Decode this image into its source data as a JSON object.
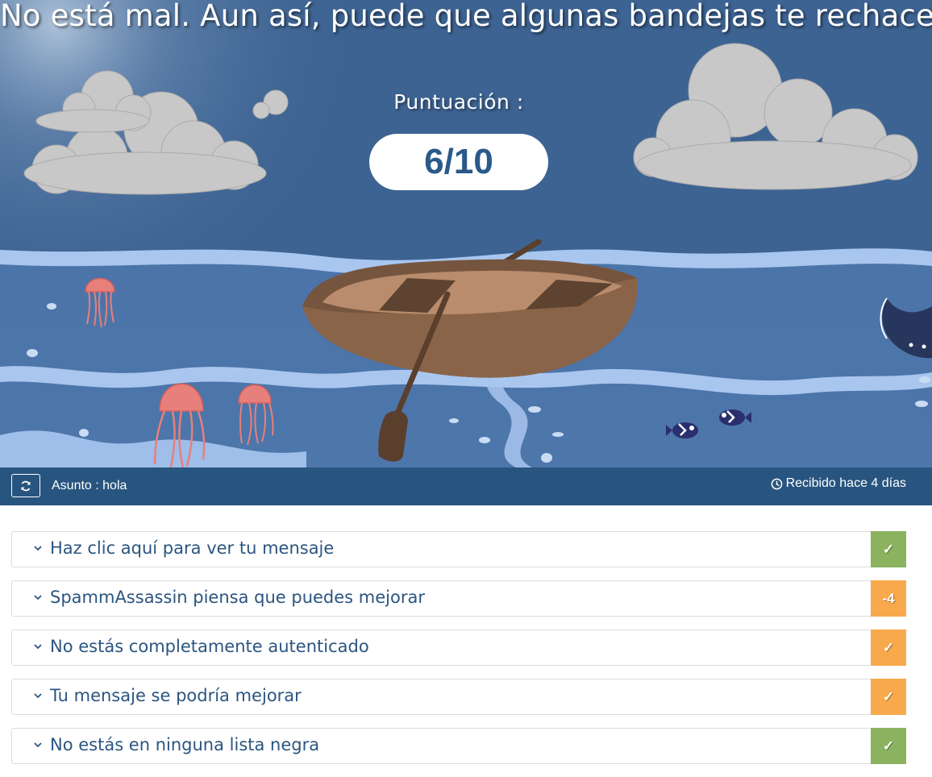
{
  "headline": "No está mal. Aun así, puede que algunas bandejas te rechacen.",
  "score": {
    "label": "Puntuación :",
    "value": "6/10"
  },
  "infobar": {
    "refresh_icon": "refresh-icon",
    "subject_label": "Asunto :",
    "subject_value": "hola",
    "clock_icon": "clock-icon",
    "received": "Recibido hace 4 días"
  },
  "colors": {
    "pass": "#8bb35f",
    "warn": "#f7a94b",
    "bar": "#28557f",
    "text": "#2b5580"
  },
  "checks": [
    {
      "label": "Haz clic aquí para ver tu mensaje",
      "badge": "✓",
      "status": "pass"
    },
    {
      "label": "SpammAssassin piensa que puedes mejorar",
      "badge": "-4",
      "status": "warn"
    },
    {
      "label": "No estás completamente autenticado",
      "badge": "✓",
      "status": "warn"
    },
    {
      "label": "Tu mensaje se podría mejorar",
      "badge": "✓",
      "status": "warn"
    },
    {
      "label": "No estás en ninguna lista negra",
      "badge": "✓",
      "status": "pass"
    }
  ]
}
